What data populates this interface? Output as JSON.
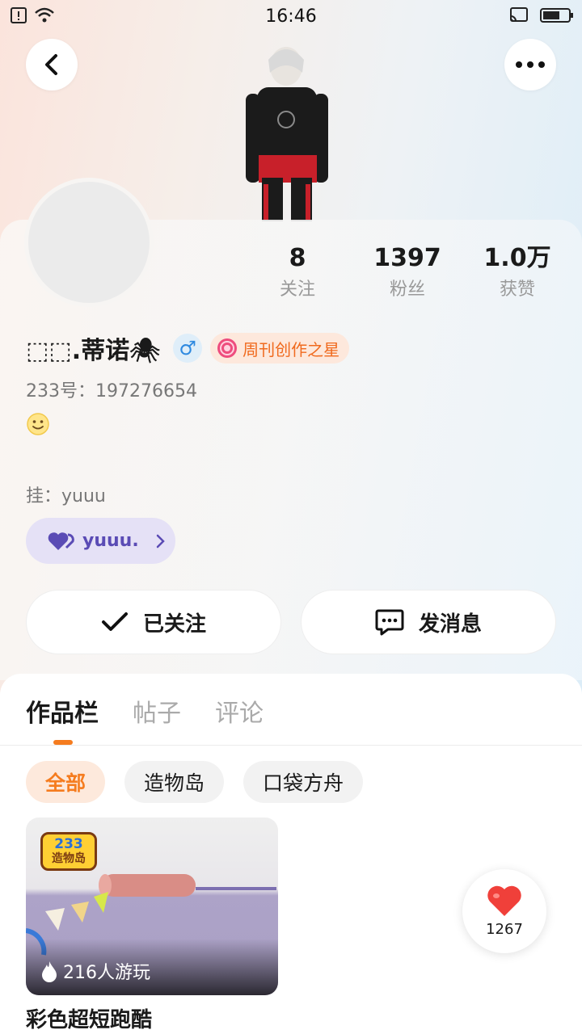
{
  "status_bar": {
    "time": "16:46"
  },
  "header": {
    "back_icon": "back-arrow-icon",
    "more_icon": "more-dots-icon"
  },
  "stats": [
    {
      "value": "8",
      "label": "关注"
    },
    {
      "value": "1397",
      "label": "粉丝"
    },
    {
      "value": "1.0万",
      "label": "获赞"
    }
  ],
  "profile": {
    "name": "⬚⬚.蒂诺🕷",
    "gender_symbol": "♂",
    "badge_label": "周刊创作之星",
    "id_text": "233号：197276654",
    "bio_emoji": "🙂",
    "guild_text": "挂：yuuu",
    "guild_chip_label": "yuuu."
  },
  "actions": {
    "follow_label": "已关注",
    "message_label": "发消息"
  },
  "tabs": [
    "作品栏",
    "帖子",
    "评论"
  ],
  "chips": [
    "全部",
    "造物岛",
    "口袋方舟"
  ],
  "game": {
    "logo_top": "233",
    "logo_bottom": "造物岛",
    "play_count": "216人游玩",
    "title": "彩色超短跑酷"
  },
  "like_button": {
    "count": "1267"
  },
  "colors": {
    "accent": "#f57c1f",
    "guild": "#5a4bb5",
    "gender": "#2f8ae0"
  }
}
